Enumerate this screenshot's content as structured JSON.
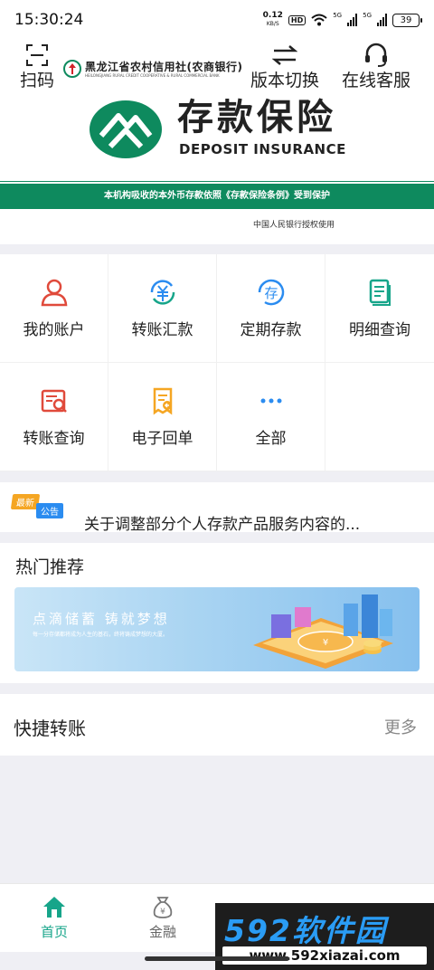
{
  "status_bar": {
    "time": "15:30:24",
    "net_speed_value": "0.12",
    "net_speed_unit": "KB/S",
    "hd_badge": "HD",
    "sim1": "5G",
    "sim2": "5G",
    "battery": "39"
  },
  "header": {
    "scan_label": "扫码",
    "version_switch_label": "版本切换",
    "customer_service_label": "在线客服",
    "bank_name_cn": "黑龙江省农村信用社(农商银行)",
    "bank_name_en": "HEILONGJIANG RURAL CREDIT COOPERATIVE & RURAL COMMERCIAL BANK"
  },
  "banner": {
    "title_cn": "存款保险",
    "title_en": "DEPOSIT INSURANCE",
    "protection_notice": "本机构吸收的本外币存款依照《存款保险条例》受到保护",
    "authorization": "中国人民银行授权使用"
  },
  "grid": {
    "items": [
      {
        "label": "我的账户",
        "icon": "user-icon"
      },
      {
        "label": "转账汇款",
        "icon": "yuan-transfer-icon"
      },
      {
        "label": "定期存款",
        "icon": "deposit-icon"
      },
      {
        "label": "明细查询",
        "icon": "document-icon"
      },
      {
        "label": "转账查询",
        "icon": "transfer-search-icon"
      },
      {
        "label": "电子回单",
        "icon": "e-receipt-icon"
      },
      {
        "label": "全部",
        "icon": "more-dots-icon"
      }
    ]
  },
  "notice": {
    "tag_new": "最新",
    "tag_announcement": "公告",
    "text": "关于调整部分个人存款产品服务内容的..."
  },
  "hot": {
    "title": "热门推荐",
    "promo_title": "点滴储蓄  铸就梦想",
    "promo_subtitle": "每一分存储都将成为人生的基石，终将铸成梦想的大厦。"
  },
  "quick_transfer": {
    "title": "快捷转账",
    "more": "更多"
  },
  "bottom_nav": {
    "items": [
      {
        "label": "首页",
        "icon": "home-icon",
        "active": true
      },
      {
        "label": "金融",
        "icon": "money-bag-icon",
        "active": false
      }
    ]
  },
  "watermark": {
    "brand": "592软件园",
    "url": "www.592xiazai.com"
  },
  "colors": {
    "brand_green": "#0e8a5e",
    "accent_red": "#e04a3b",
    "accent_blue": "#2b8cf0",
    "accent_teal": "#17a58a",
    "accent_orange": "#f5a623"
  }
}
